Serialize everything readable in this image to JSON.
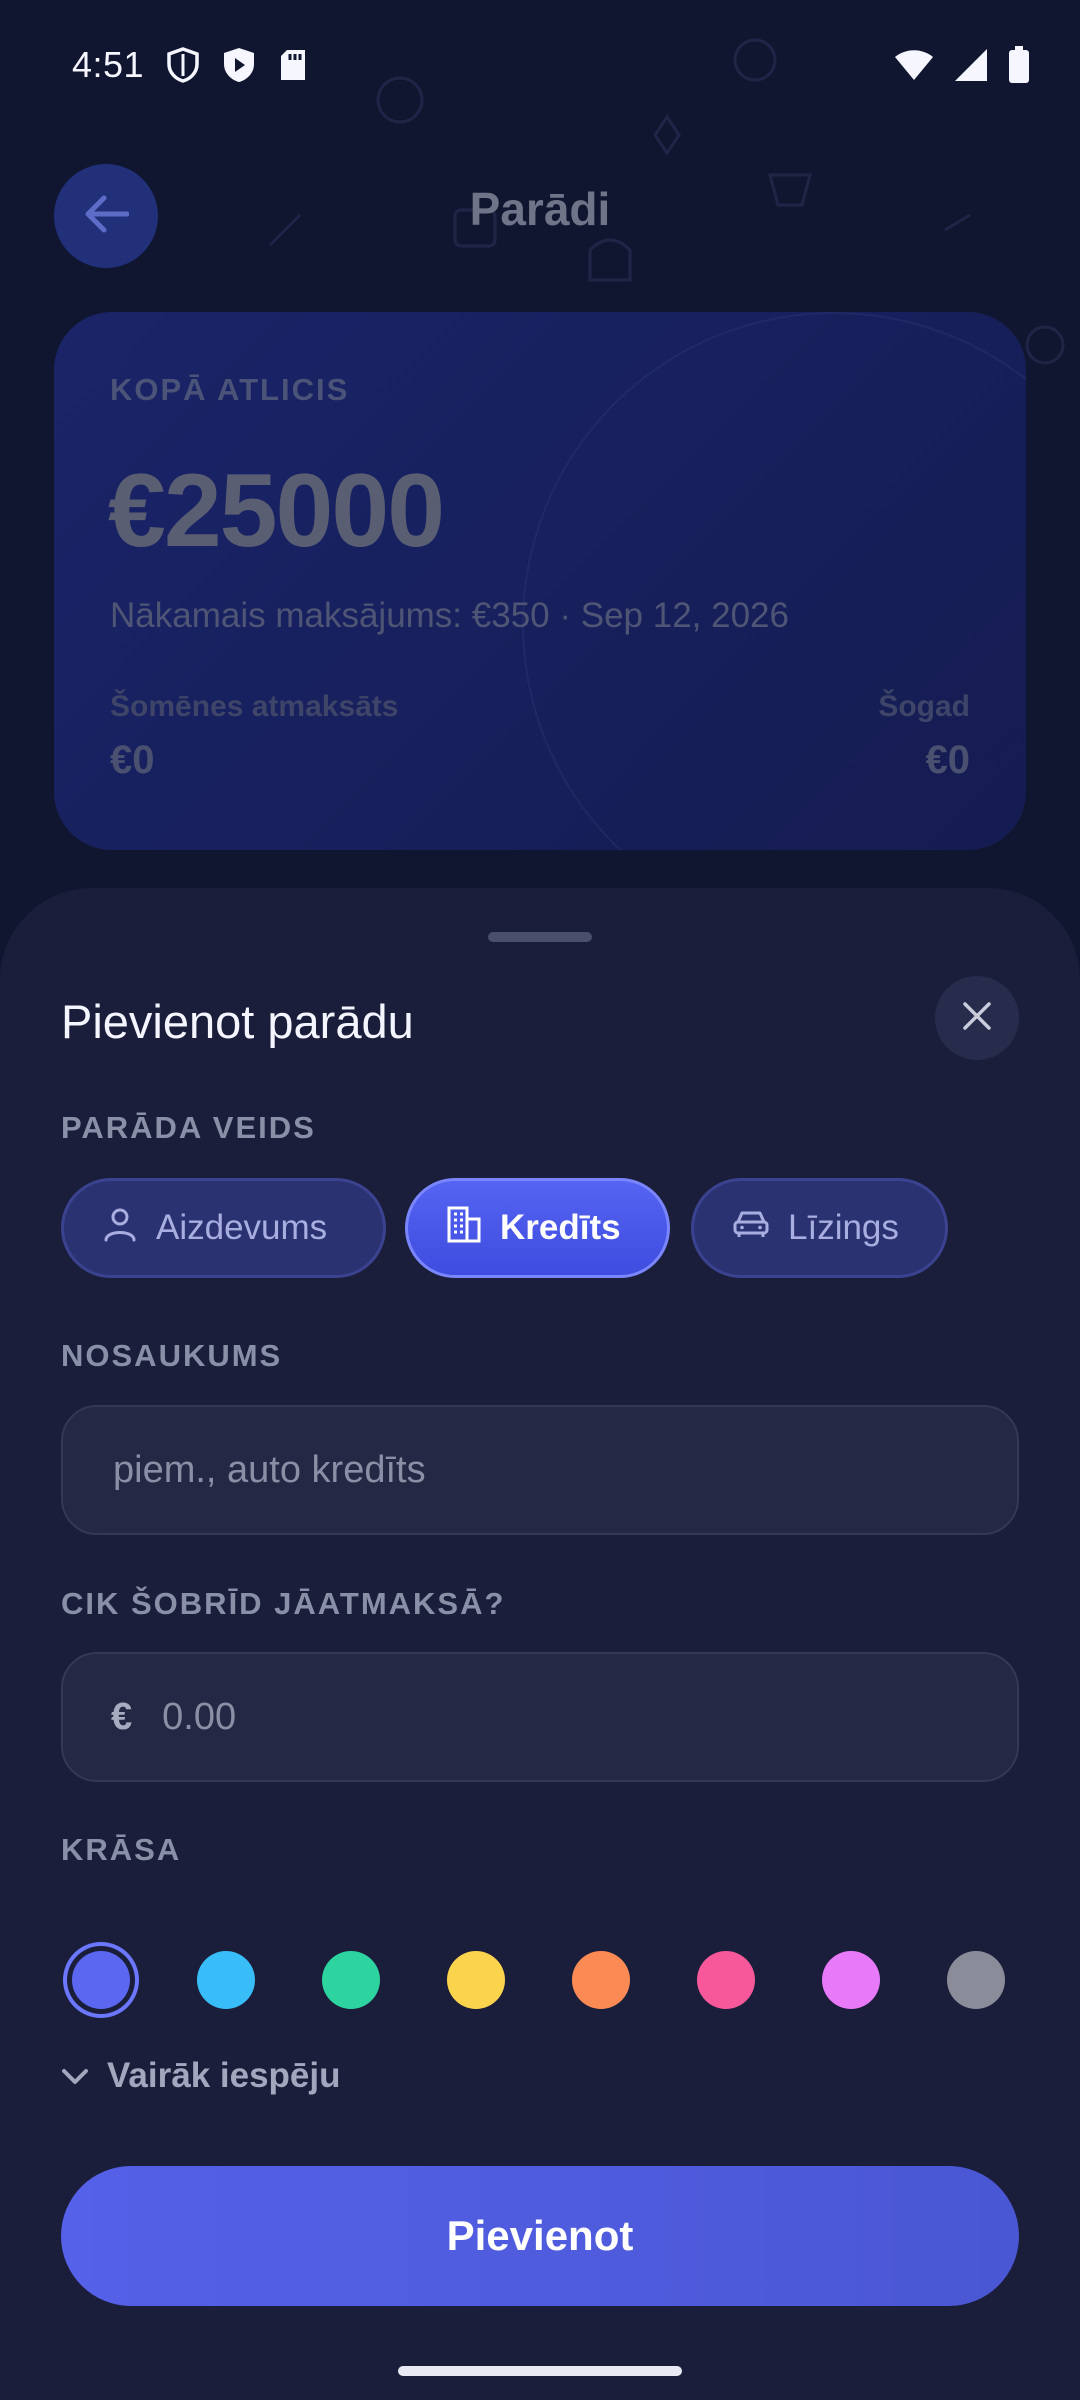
{
  "status_bar": {
    "time": "4:51",
    "icons_left": [
      "shield-outline-icon",
      "shield-play-icon",
      "sd-card-icon"
    ],
    "icons_right": [
      "wifi-icon",
      "signal-icon",
      "battery-icon"
    ]
  },
  "background": {
    "page_title": "Parādi",
    "summary": {
      "label": "KOPĀ ATLICIS",
      "amount": "€25000",
      "next_payment": "Nākamais maksājums: €350 · Sep 12, 2026",
      "this_month_label": "Šomēnes atmaksāts",
      "this_month_value": "€0",
      "this_year_label": "Šogad",
      "this_year_value": "€0"
    }
  },
  "sheet": {
    "title": "Pievienot parādu",
    "type_label": "PARĀDA VEIDS",
    "types": [
      {
        "label": "Aizdevums",
        "icon": "person-icon",
        "selected": false
      },
      {
        "label": "Kredīts",
        "icon": "building-icon",
        "selected": true
      },
      {
        "label": "Līzings",
        "icon": "car-icon",
        "selected": false
      }
    ],
    "name_label": "NOSAUKUMS",
    "name_placeholder": "piem., auto kredīts",
    "amount_label": "CIK ŠOBRĪD JĀATMAKSĀ?",
    "amount_prefix": "€",
    "amount_placeholder": "0.00",
    "color_label": "KRĀSA",
    "colors": [
      "#5b67f0",
      "#38bdf8",
      "#2dd4a0",
      "#fcd34d",
      "#fb8a55",
      "#f7589a",
      "#e879f9",
      "#8b8c99"
    ],
    "selected_color_index": 0,
    "more_options_label": "Vairāk iespēju",
    "submit_label": "Pievienot"
  }
}
